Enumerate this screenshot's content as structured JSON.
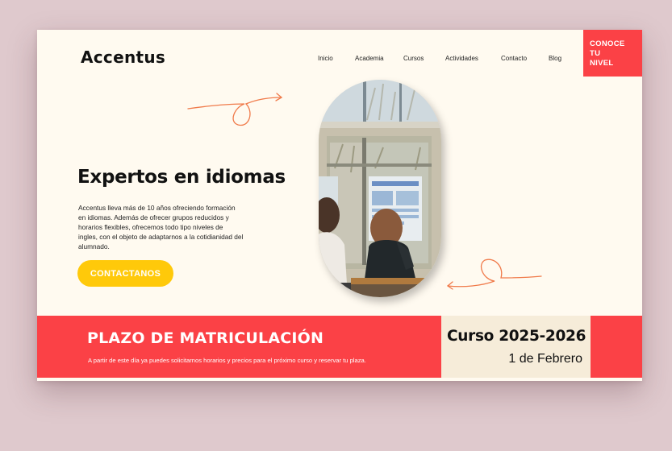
{
  "header": {
    "logo": "Accentus",
    "nav": [
      {
        "label": "Inicio"
      },
      {
        "label": "Academia"
      },
      {
        "label": "Cursos"
      },
      {
        "label": "Actividades"
      },
      {
        "label": "Contacto"
      },
      {
        "label": "Blog"
      }
    ],
    "cta_label": "CONOCE\nTU\nNIVEL"
  },
  "hero": {
    "title": "Expertos en idiomas",
    "description": "Accentus lleva más de 10 años ofreciendo formación en idiomas. Además de ofrecer grupos reducidos y horarios flexibles, ofrecemos todo tipo niveles de ingles, con el objeto de adaptarnos a la cotidianidad del alumnado.",
    "button_label": "CONTACTANOS",
    "photo_icon": "classroom-photo"
  },
  "banner": {
    "title": "PLAZO DE MATRICULACIÓN",
    "text": "A partir de este día ya puedes solicitarnos horarios y precios para el próximo curso y reservar tu plaza.",
    "course_title": "Curso 2025-2026",
    "course_date": "1 de Febrero"
  },
  "colors": {
    "accent_red": "#fb4146",
    "accent_yellow": "#ffc90a",
    "background": "#fffaf0",
    "doodle_orange": "#f07a4a"
  }
}
